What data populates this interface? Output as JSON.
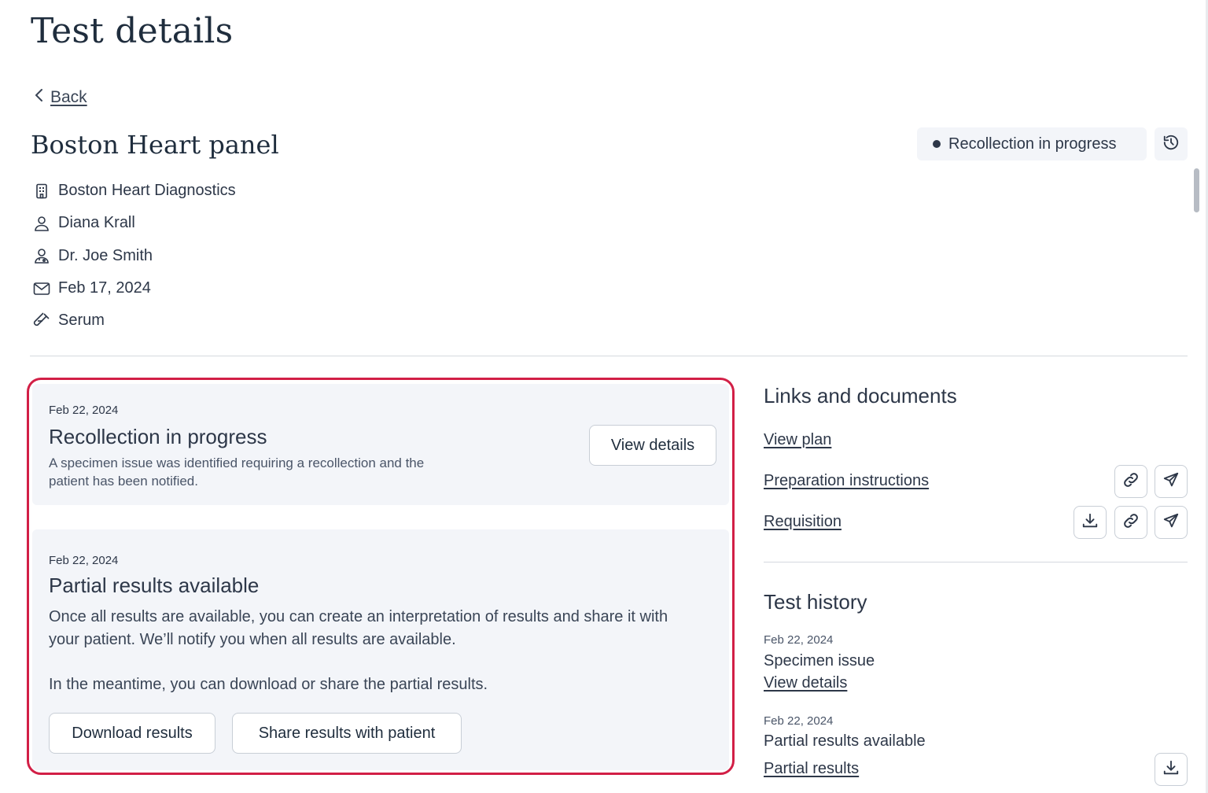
{
  "page": {
    "title": "Test details",
    "back_label": "Back"
  },
  "test": {
    "name": "Boston Heart panel",
    "status": "Recollection in progress",
    "meta": [
      {
        "icon": "building-icon",
        "text": "Boston Heart Diagnostics"
      },
      {
        "icon": "user-icon",
        "text": "Diana Krall"
      },
      {
        "icon": "doctor-icon",
        "text": "Dr. Joe Smith"
      },
      {
        "icon": "envelope-icon",
        "text": "Feb 17, 2024"
      },
      {
        "icon": "test-tube-icon",
        "text": "Serum"
      }
    ]
  },
  "cards": {
    "recollection": {
      "date": "Feb 22, 2024",
      "title": "Recollection in progress",
      "description_line1": "A specimen issue was identified requiring a recollection and the",
      "description_line2": "patient has been notified.",
      "button": "View details"
    },
    "partial": {
      "date": "Feb 22, 2024",
      "title": "Partial results available",
      "para1_line1": "Once all results are available, you can create an interpretation of results and share it with",
      "para1_line2": "your patient. We’ll notify you when all results are available.",
      "para2": "In the meantime, you can download or share the partial results.",
      "download_button": "Download results",
      "share_button": "Share results with patient"
    }
  },
  "links_documents": {
    "title": "Links and documents",
    "items": [
      {
        "label": "View plan"
      },
      {
        "label": "Preparation instructions"
      },
      {
        "label": "Requisition"
      }
    ]
  },
  "test_history": {
    "title": "Test history",
    "entries": [
      {
        "date": "Feb 22, 2024",
        "label": "Specimen issue",
        "link": "View details"
      },
      {
        "date": "Feb 22, 2024",
        "label": "Partial results available",
        "link": "Partial results"
      }
    ]
  },
  "colors": {
    "highlight_border": "#d21f46",
    "card_bg": "#f3f5f9",
    "text": "#2d3748"
  }
}
